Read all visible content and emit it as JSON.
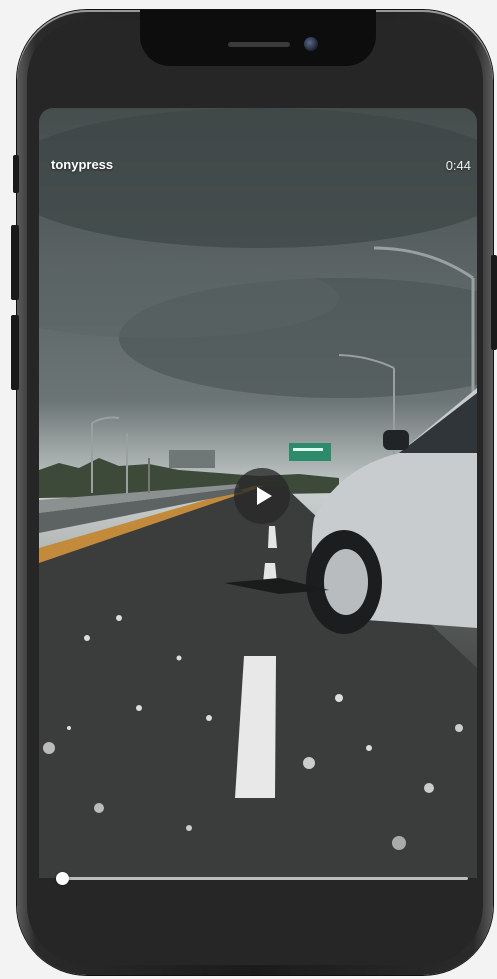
{
  "video": {
    "username": "tonypress",
    "duration": "0:44",
    "progress": 0.0,
    "play_icon": "play-icon"
  },
  "colors": {
    "frame": "#1b1b1b",
    "screen_bg": "#262626",
    "progress_track": "#bdbdbd",
    "progress_fill": "#ffffff",
    "play_button_bg": "#282828"
  }
}
